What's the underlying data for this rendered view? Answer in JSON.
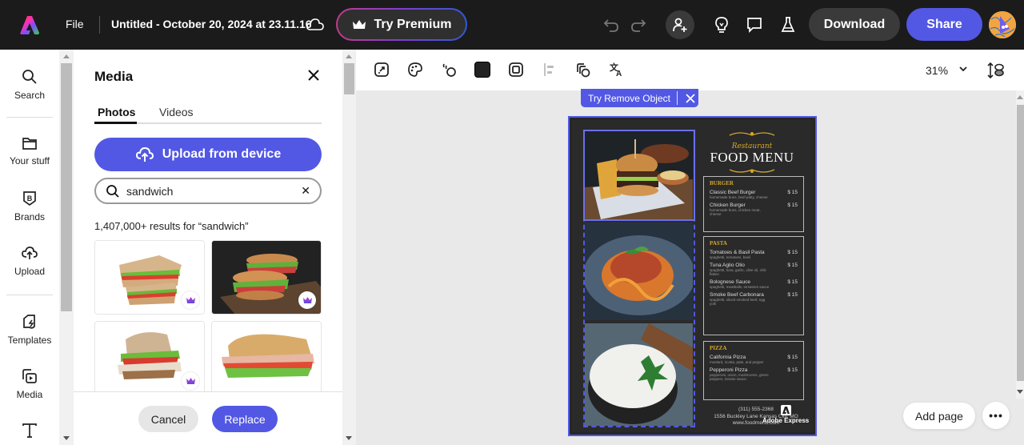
{
  "topbar": {
    "file_label": "File",
    "doc_title": "Untitled - October 20, 2024 at 23.11.16",
    "premium_label": "Try Premium",
    "download_label": "Download",
    "share_label": "Share",
    "icons": [
      "adobe-express-logo",
      "cloud-sync-icon",
      "crown-icon",
      "undo-icon",
      "redo-icon",
      "invite-user-icon",
      "lightbulb-icon",
      "comment-icon",
      "labs-flask-icon",
      "avatar"
    ]
  },
  "rail": {
    "items": [
      {
        "label": "Search",
        "icon": "search-icon"
      },
      {
        "label": "Your stuff",
        "icon": "folder-icon"
      },
      {
        "label": "Brands",
        "icon": "brand-icon"
      },
      {
        "label": "Upload",
        "icon": "cloud-upload-icon"
      },
      {
        "label": "Templates",
        "icon": "templates-icon"
      },
      {
        "label": "Media",
        "icon": "media-icon"
      },
      {
        "label": "Text",
        "icon": "text-icon"
      }
    ]
  },
  "panel": {
    "title": "Media",
    "tabs": [
      {
        "label": "Photos",
        "active": true
      },
      {
        "label": "Videos",
        "active": false
      }
    ],
    "upload_label": "Upload from device",
    "search_value": "sandwich",
    "search_placeholder": "Search",
    "results_text": "1,407,000+ results for “sandwich”",
    "thumbnails": [
      {
        "alt": "Club sandwich halves",
        "premium": true
      },
      {
        "alt": "Sub sandwiches on wooden board",
        "premium": true
      },
      {
        "alt": "Turkey sandwich",
        "premium": true
      },
      {
        "alt": "Baguette sub sandwich",
        "premium": false
      }
    ],
    "cancel_label": "Cancel",
    "replace_label": "Replace"
  },
  "toolbar": {
    "tools": [
      "replace-image-icon",
      "color-palette-icon",
      "animate-icon",
      "fill-color-swatch",
      "border-icon",
      "align-icon",
      "layers-icon",
      "translate-icon"
    ],
    "zoom_value": "31%"
  },
  "canvas": {
    "remove_object_label": "Try Remove Object",
    "add_page_label": "Add page",
    "more_label": "•••",
    "menu": {
      "subtitle": "Restaurant",
      "title": "FOOD MENU",
      "sections": [
        {
          "name": "BURGER",
          "items": [
            {
              "name": "Classic Beef Burger",
              "desc": "homemade buns, beef patty, cheese",
              "price": "$ 15"
            },
            {
              "name": "Chicken Burger",
              "desc": "homemade buns, chicken meat, cheese",
              "price": "$ 15"
            }
          ]
        },
        {
          "name": "PASTA",
          "items": [
            {
              "name": "Tomatoes & Basil Pasta",
              "desc": "spaghetti, tomatoes, basil",
              "price": "$ 15"
            },
            {
              "name": "Tuna Aglio Olio",
              "desc": "spaghetti, tuna, garlic, olive oil, chili flakes",
              "price": "$ 15"
            },
            {
              "name": "Bolognese Sauce",
              "desc": "spaghetti, meatballs, tomatoes sauce",
              "price": "$ 15"
            },
            {
              "name": "Smoke Beef Carbonara",
              "desc": "spaghetti, sliced smoked beef, egg yolk",
              "price": "$ 15"
            }
          ]
        },
        {
          "name": "PIZZA",
          "items": [
            {
              "name": "California Pizza",
              "desc": "mustard, ricotta, pate, and pepper",
              "price": "$ 15"
            },
            {
              "name": "Pepperoni Pizza",
              "desc": "pepperoni, onion, mushrooms, green peppers, tomato sauce.",
              "price": "$ 15"
            }
          ]
        }
      ],
      "phone": "(311) 555-2368",
      "address": "1556 Buckley Lane Kansas City, MO",
      "website": "www.foodmenu.com",
      "watermark": "Adobe Express"
    }
  },
  "colors": {
    "accent": "#5258e4",
    "topbar": "#1b1b1b",
    "gold": "#d6a82a",
    "menu_bg": "#2a2a2a"
  }
}
